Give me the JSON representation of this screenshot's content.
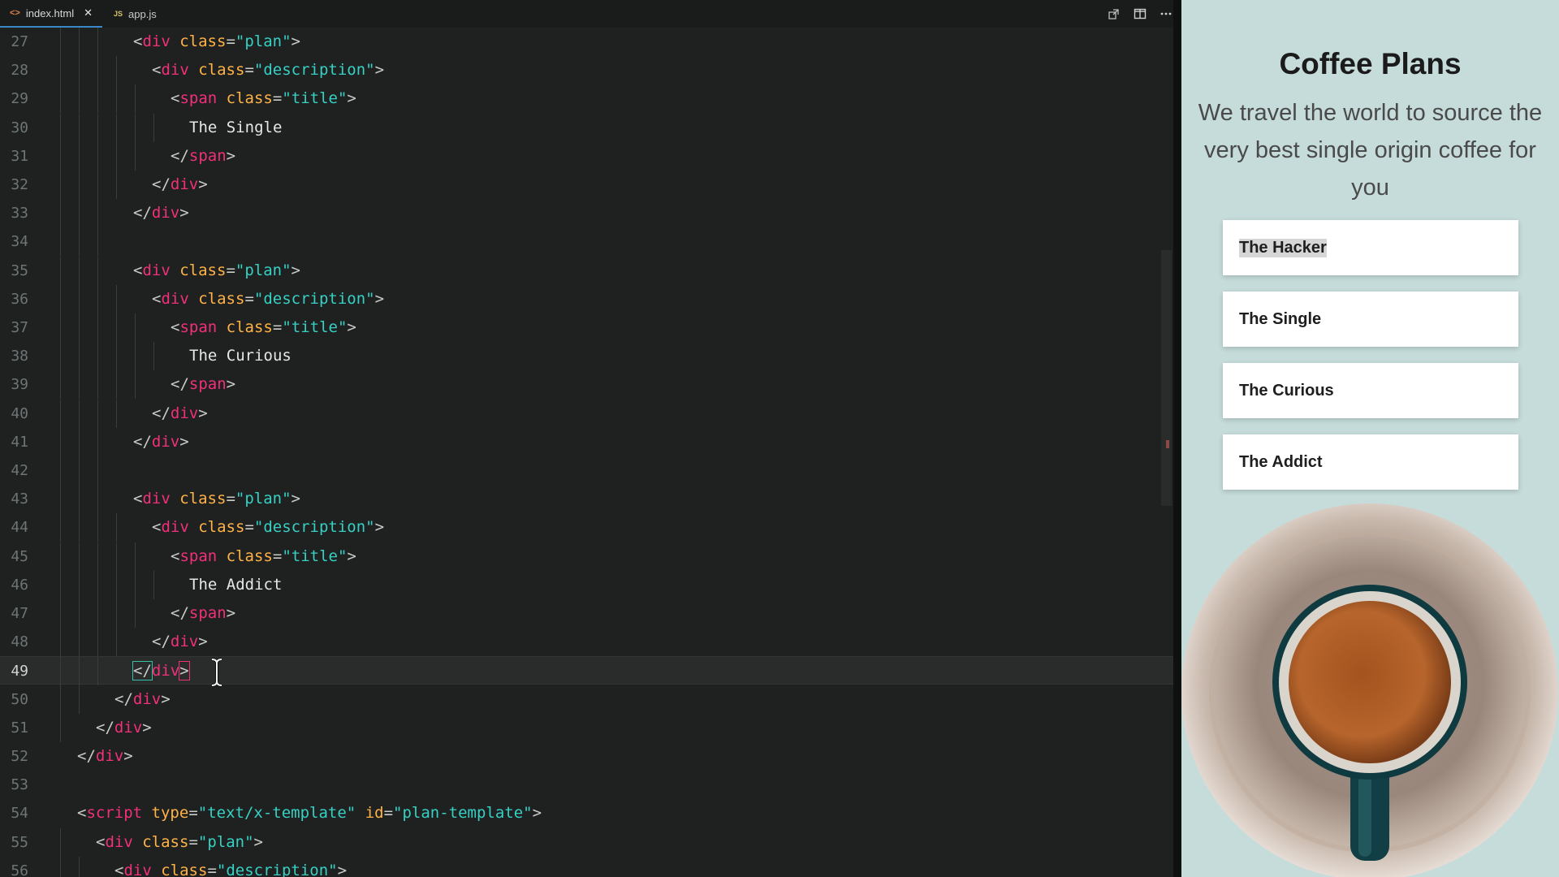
{
  "tabs": [
    {
      "label": "index.html",
      "icon": "html-file-icon",
      "active": true
    },
    {
      "label": "app.js",
      "icon": "js-file-icon",
      "active": false
    }
  ],
  "tab_icons": {
    "html": "<>",
    "js": "JS",
    "close": "✕"
  },
  "lines": [
    {
      "n": "27",
      "indent": 3,
      "code": [
        [
          "p",
          "<"
        ],
        [
          "t",
          "div"
        ],
        [
          "x",
          " "
        ],
        [
          "a",
          "class"
        ],
        [
          "p",
          "="
        ],
        [
          "s",
          "\"plan\""
        ],
        [
          "p",
          ">"
        ]
      ]
    },
    {
      "n": "28",
      "indent": 4,
      "code": [
        [
          "p",
          "<"
        ],
        [
          "t",
          "div"
        ],
        [
          "x",
          " "
        ],
        [
          "a",
          "class"
        ],
        [
          "p",
          "="
        ],
        [
          "s",
          "\"description\""
        ],
        [
          "p",
          ">"
        ]
      ]
    },
    {
      "n": "29",
      "indent": 5,
      "code": [
        [
          "p",
          "<"
        ],
        [
          "t",
          "span"
        ],
        [
          "x",
          " "
        ],
        [
          "a",
          "class"
        ],
        [
          "p",
          "="
        ],
        [
          "s",
          "\"title\""
        ],
        [
          "p",
          ">"
        ]
      ]
    },
    {
      "n": "30",
      "indent": 6,
      "code": [
        [
          "x",
          "The Single"
        ]
      ]
    },
    {
      "n": "31",
      "indent": 5,
      "code": [
        [
          "p",
          "</"
        ],
        [
          "t",
          "span"
        ],
        [
          "p",
          ">"
        ]
      ]
    },
    {
      "n": "32",
      "indent": 4,
      "code": [
        [
          "p",
          "</"
        ],
        [
          "t",
          "div"
        ],
        [
          "p",
          ">"
        ]
      ]
    },
    {
      "n": "33",
      "indent": 3,
      "code": [
        [
          "p",
          "</"
        ],
        [
          "t",
          "div"
        ],
        [
          "p",
          ">"
        ]
      ]
    },
    {
      "n": "34",
      "indent": 3,
      "code": []
    },
    {
      "n": "35",
      "indent": 3,
      "code": [
        [
          "p",
          "<"
        ],
        [
          "t",
          "div"
        ],
        [
          "x",
          " "
        ],
        [
          "a",
          "class"
        ],
        [
          "p",
          "="
        ],
        [
          "s",
          "\"plan\""
        ],
        [
          "p",
          ">"
        ]
      ]
    },
    {
      "n": "36",
      "indent": 4,
      "code": [
        [
          "p",
          "<"
        ],
        [
          "t",
          "div"
        ],
        [
          "x",
          " "
        ],
        [
          "a",
          "class"
        ],
        [
          "p",
          "="
        ],
        [
          "s",
          "\"description\""
        ],
        [
          "p",
          ">"
        ]
      ]
    },
    {
      "n": "37",
      "indent": 5,
      "code": [
        [
          "p",
          "<"
        ],
        [
          "t",
          "span"
        ],
        [
          "x",
          " "
        ],
        [
          "a",
          "class"
        ],
        [
          "p",
          "="
        ],
        [
          "s",
          "\"title\""
        ],
        [
          "p",
          ">"
        ]
      ]
    },
    {
      "n": "38",
      "indent": 6,
      "code": [
        [
          "x",
          "The Curious"
        ]
      ]
    },
    {
      "n": "39",
      "indent": 5,
      "code": [
        [
          "p",
          "</"
        ],
        [
          "t",
          "span"
        ],
        [
          "p",
          ">"
        ]
      ]
    },
    {
      "n": "40",
      "indent": 4,
      "code": [
        [
          "p",
          "</"
        ],
        [
          "t",
          "div"
        ],
        [
          "p",
          ">"
        ]
      ]
    },
    {
      "n": "41",
      "indent": 3,
      "code": [
        [
          "p",
          "</"
        ],
        [
          "t",
          "div"
        ],
        [
          "p",
          ">"
        ]
      ]
    },
    {
      "n": "42",
      "indent": 3,
      "code": []
    },
    {
      "n": "43",
      "indent": 3,
      "code": [
        [
          "p",
          "<"
        ],
        [
          "t",
          "div"
        ],
        [
          "x",
          " "
        ],
        [
          "a",
          "class"
        ],
        [
          "p",
          "="
        ],
        [
          "s",
          "\"plan\""
        ],
        [
          "p",
          ">"
        ]
      ]
    },
    {
      "n": "44",
      "indent": 4,
      "code": [
        [
          "p",
          "<"
        ],
        [
          "t",
          "div"
        ],
        [
          "x",
          " "
        ],
        [
          "a",
          "class"
        ],
        [
          "p",
          "="
        ],
        [
          "s",
          "\"description\""
        ],
        [
          "p",
          ">"
        ]
      ]
    },
    {
      "n": "45",
      "indent": 5,
      "code": [
        [
          "p",
          "<"
        ],
        [
          "t",
          "span"
        ],
        [
          "x",
          " "
        ],
        [
          "a",
          "class"
        ],
        [
          "p",
          "="
        ],
        [
          "s",
          "\"title\""
        ],
        [
          "p",
          ">"
        ]
      ]
    },
    {
      "n": "46",
      "indent": 6,
      "code": [
        [
          "x",
          "The Addict"
        ]
      ]
    },
    {
      "n": "47",
      "indent": 5,
      "code": [
        [
          "p",
          "</"
        ],
        [
          "t",
          "span"
        ],
        [
          "p",
          ">"
        ]
      ]
    },
    {
      "n": "48",
      "indent": 4,
      "code": [
        [
          "p",
          "</"
        ],
        [
          "t",
          "div"
        ],
        [
          "p",
          ">"
        ]
      ]
    },
    {
      "n": "49",
      "indent": 3,
      "current": true,
      "code": [
        [
          "p",
          "</"
        ],
        [
          "t",
          "div"
        ],
        [
          "p",
          ">"
        ]
      ]
    },
    {
      "n": "50",
      "indent": 2,
      "code": [
        [
          "p",
          "</"
        ],
        [
          "t",
          "div"
        ],
        [
          "p",
          ">"
        ]
      ]
    },
    {
      "n": "51",
      "indent": 1,
      "code": [
        [
          "p",
          "</"
        ],
        [
          "t",
          "div"
        ],
        [
          "p",
          ">"
        ]
      ]
    },
    {
      "n": "52",
      "indent": 0,
      "code": [
        [
          "p",
          "</"
        ],
        [
          "t",
          "div"
        ],
        [
          "p",
          ">"
        ]
      ]
    },
    {
      "n": "53",
      "indent": 0,
      "code": []
    },
    {
      "n": "54",
      "indent": 0,
      "code": [
        [
          "p",
          "<"
        ],
        [
          "t",
          "script"
        ],
        [
          "x",
          " "
        ],
        [
          "a",
          "type"
        ],
        [
          "p",
          "="
        ],
        [
          "s",
          "\"text/x-template\""
        ],
        [
          "x",
          " "
        ],
        [
          "a",
          "id"
        ],
        [
          "p",
          "="
        ],
        [
          "s",
          "\"plan-template\""
        ],
        [
          "p",
          ">"
        ]
      ]
    },
    {
      "n": "55",
      "indent": 1,
      "code": [
        [
          "p",
          "<"
        ],
        [
          "t",
          "div"
        ],
        [
          "x",
          " "
        ],
        [
          "a",
          "class"
        ],
        [
          "p",
          "="
        ],
        [
          "s",
          "\"plan\""
        ],
        [
          "p",
          ">"
        ]
      ]
    },
    {
      "n": "56",
      "indent": 2,
      "code": [
        [
          "p",
          "<"
        ],
        [
          "t",
          "div"
        ],
        [
          "x",
          " "
        ],
        [
          "a",
          "class"
        ],
        [
          "p",
          "="
        ],
        [
          "s",
          "\"description\""
        ],
        [
          "p",
          ">"
        ]
      ]
    }
  ],
  "preview": {
    "title": "Coffee Plans",
    "subtitle": "We travel the world to source the very best single origin coffee for you",
    "plans": [
      {
        "name": "The Hacker",
        "selected": true
      },
      {
        "name": "The Single",
        "selected": false
      },
      {
        "name": "The Curious",
        "selected": false
      },
      {
        "name": "The Addict",
        "selected": false
      }
    ]
  },
  "colors": {
    "tag": "#f0317a",
    "attr": "#ffb347",
    "string": "#36d1c4",
    "preview_bg": "#c5dcda",
    "active_tab_border": "#3b88c8"
  }
}
